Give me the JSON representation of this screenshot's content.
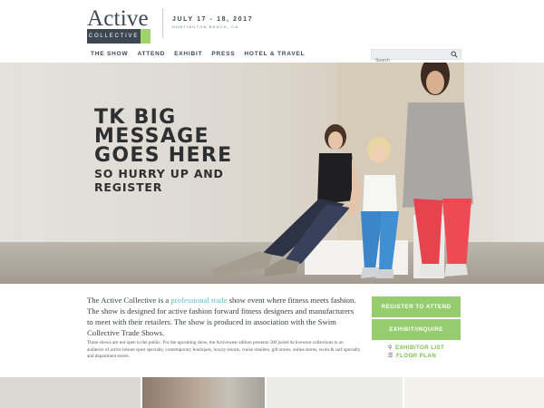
{
  "header": {
    "logo_word": "Active",
    "logo_tag": "COLLECTIVE",
    "date": "JULY 17 - 18, 2017",
    "location": "HUNTINGTON BEACH, CA"
  },
  "nav": {
    "items": [
      "THE SHOW",
      "ATTEND",
      "EXHIBIT",
      "PRESS",
      "HOTEL & TRAVEL"
    ]
  },
  "search": {
    "placeholder": "Search",
    "icon": "search-icon"
  },
  "hero": {
    "headline_lines": [
      "TK BIG",
      "MESSAGE",
      "GOES HERE"
    ],
    "sub_lines": [
      "SO HURRY UP AND",
      "REGISTER"
    ]
  },
  "intro": {
    "text_before": "The Active Collective is a ",
    "link": "professional trade",
    "text_after": " show event where fitness meets fashion. The show is designed for active fashion forward fitness designers and manufacturers to meet with their retailers. The show is produced in association with the Swim Collective Trade Shows."
  },
  "note": "These shows are not open to the public. For the upcoming show, the Activewear edition presents 500 juried Activewear collections to an audience of active leisure sport specialty, contemporary boutiques, luxury resorts, cruise retailers, gift stores, online stores, swim & surf specialty and department stores.",
  "actions": {
    "register": "REGISTER TO ATTEND",
    "exhibit": "EXHIBIT/INQUIRE",
    "exhibitor_list": "EXHIBITOR LIST",
    "floor_plan": "FLOOR PLAN"
  },
  "colors": {
    "accent_green": "#95cd6e",
    "link_teal": "#5fbcc4",
    "navy": "#3e4852"
  }
}
